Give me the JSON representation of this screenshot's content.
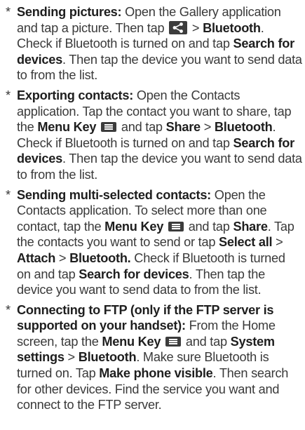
{
  "bullet_symbol": "*",
  "icons": {
    "share": "share-icon",
    "menu_key": "menu-key-icon"
  },
  "items": [
    {
      "title": "Sending pictures:",
      "text": {
        "t1": " Open the Gallery application and tap a picture. Then tap ",
        "t2": " > ",
        "b1": "Bluetooth",
        "t3": ". Check if Bluetooth is turned on and tap ",
        "b2": "Search for devices",
        "t4": ". Then tap the device you want to send data to from the list."
      }
    },
    {
      "title": "Exporting contacts:",
      "text": {
        "t1": " Open the Contacts application. Tap the contact you want to share, tap the ",
        "b1": "Menu Key",
        "t2": " and tap ",
        "b2": "Share",
        "t3": " > ",
        "b3": "Bluetooth",
        "t4": ". Check if Bluetooth is turned on and tap ",
        "b4": "Search for devices",
        "t5": ". Then tap the device you want to send data to from the list."
      }
    },
    {
      "title": "Sending multi-selected contacts:",
      "text": {
        "t1": " Open the Contacts application. To select more than one contact, tap the ",
        "b1": "Menu Key",
        "t2": " and tap ",
        "b2": "Share",
        "t3": ". Tap the contacts you want to send or tap ",
        "b3": "Select all",
        "t4": " > ",
        "b4": "Attach",
        "t5": " > ",
        "b5": "Bluetooth.",
        "t6": " Check if Bluetooth is turned on and tap ",
        "b6": "Search for devices",
        "t7": ". Then tap the device you want to send data to from the list."
      }
    },
    {
      "title": "Connecting to FTP (only if the FTP server is supported on your handset):",
      "text": {
        "t1": " From the Home screen, tap the ",
        "b1": "Menu Key",
        "t2": " and tap ",
        "b2": "System settings",
        "t3": " > ",
        "b3": "Bluetooth",
        "t4": ". Make sure Bluetooth is turned on. Tap ",
        "b4": "Make phone visible",
        "t5": ". Then search for other devices. Find the service you want and connect to the FTP server."
      }
    }
  ]
}
